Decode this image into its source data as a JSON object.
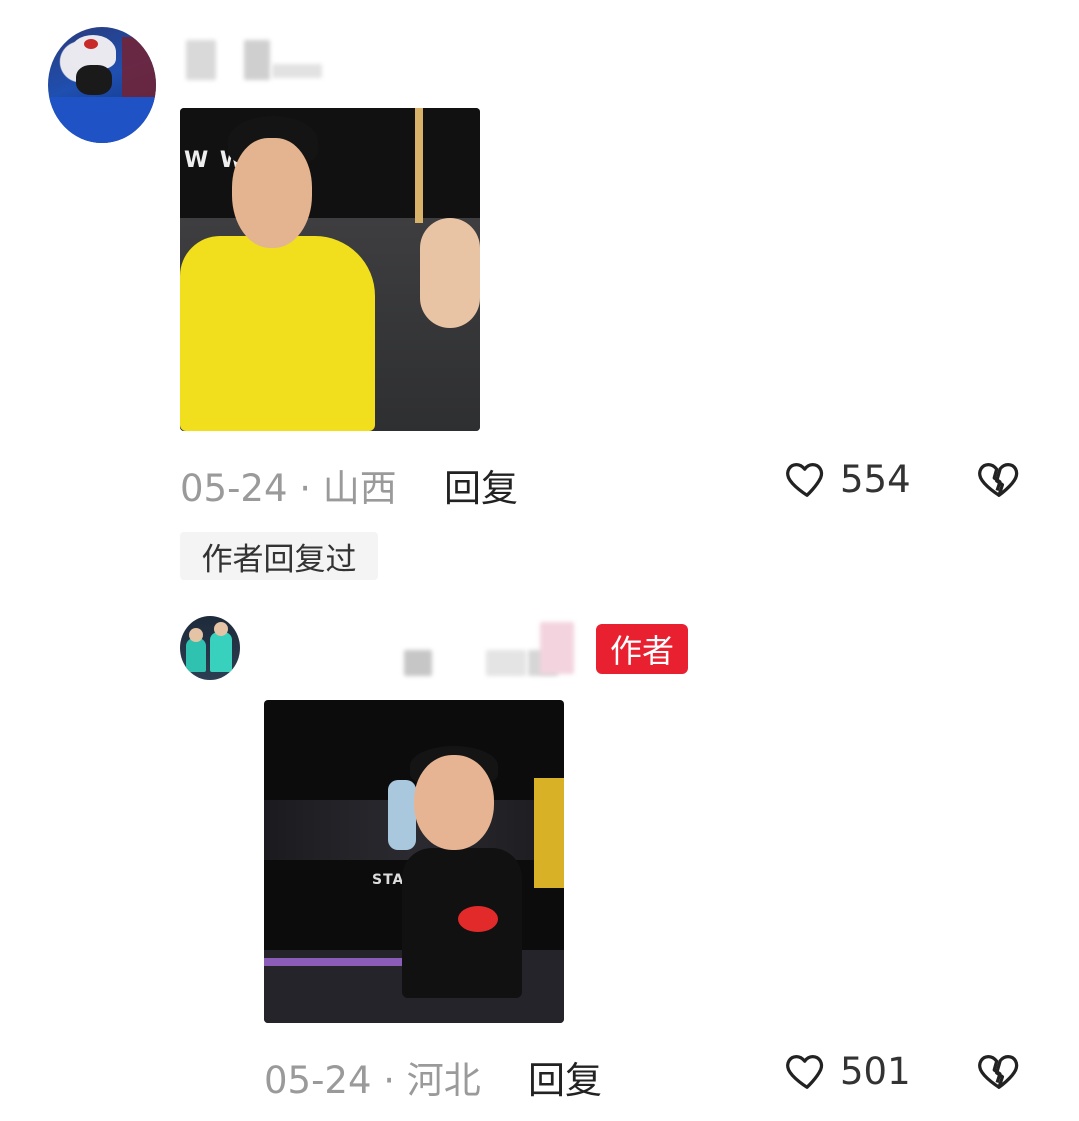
{
  "comments": [
    {
      "date_location": "05-24 · 山西",
      "reply_label": "回复",
      "likes": "554",
      "author_replied_label": "作者回复过"
    },
    {
      "author_badge": "作者",
      "date_location": "05-24 · 河北",
      "reply_label": "回复",
      "likes": "501"
    }
  ],
  "icons": {
    "like": "heart-outline-icon",
    "dislike": "broken-heart-icon"
  },
  "colors": {
    "author_badge_bg": "#e8202f",
    "meta_text": "#9a9a9a"
  }
}
